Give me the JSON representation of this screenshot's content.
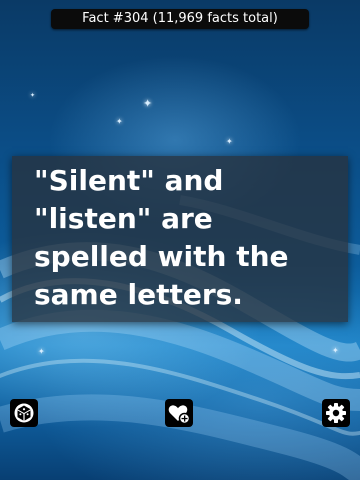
{
  "header": {
    "title": "Fact #304 (11,969 facts total)"
  },
  "fact": {
    "text": "\"Silent\" and \"listen\" are spelled with the same letters."
  },
  "toolbar": {
    "left_icon": "shuffle-dice-icon",
    "middle_icon": "add-favorite-heart-icon",
    "right_icon": "gear-icon"
  },
  "colors": {
    "background_top": "#0a3a66",
    "background_glow": "#1a80c4",
    "card": "#28323e",
    "button": "#000000",
    "text": "#ffffff"
  }
}
